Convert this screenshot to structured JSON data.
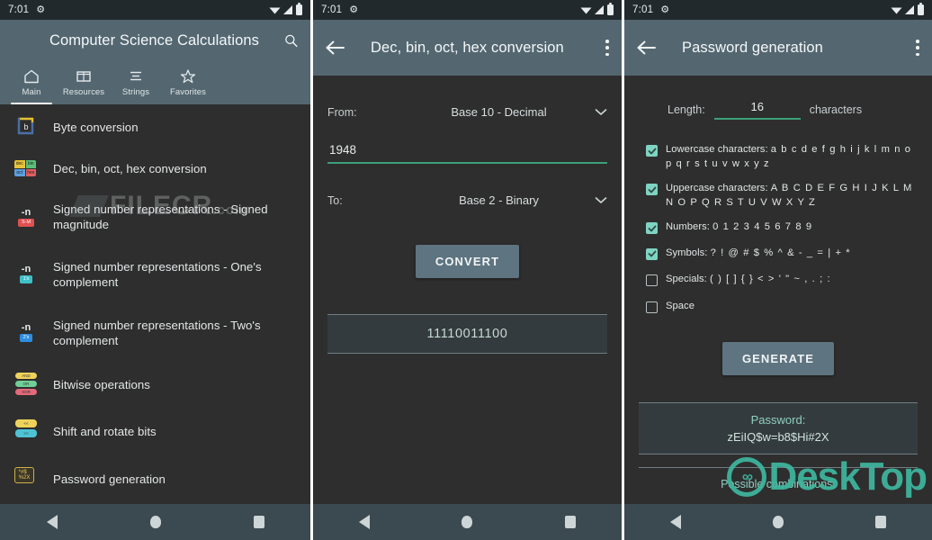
{
  "status_bar": {
    "time": "7:01",
    "gear_icon": "gear-icon",
    "wifi_icon": "wifi-icon",
    "signal_icon": "signal-icon",
    "battery_icon": "battery-icon"
  },
  "colors": {
    "appbar": "#546771",
    "background": "#2e2e2e",
    "accent_underline": "#3ba07a",
    "checkbox_checked": "#7fd3c2",
    "result_text": "#8fd0c2",
    "button": "#5e7480",
    "watermark": "#3fb79f"
  },
  "screen_main": {
    "title": "Computer Science Calculations",
    "menu_icon": "hamburger-menu-icon",
    "search_icon": "search-icon",
    "tabs": [
      {
        "label": "Main",
        "icon": "home-icon",
        "active": true
      },
      {
        "label": "Resources",
        "icon": "table-icon",
        "active": false
      },
      {
        "label": "Strings",
        "icon": "text-lines-icon",
        "active": false
      },
      {
        "label": "Favorites",
        "icon": "star-icon",
        "active": false
      }
    ],
    "list": [
      {
        "label": "Byte conversion",
        "icon": "byte-icon"
      },
      {
        "label": "Dec, bin, oct, hex conversion",
        "icon": "base-grid-icon"
      },
      {
        "label": "Signed number representations - Signed magnitude",
        "icon": "signed-magnitude-icon",
        "tag": "S-M"
      },
      {
        "label": "Signed number representations - One's complement",
        "icon": "ones-complement-icon",
        "tag": "1's"
      },
      {
        "label": "Signed number representations - Two's complement",
        "icon": "twos-complement-icon",
        "tag": "2's"
      },
      {
        "label": "Bitwise operations",
        "icon": "bitwise-icon",
        "pills": [
          "AND",
          "OR",
          "XOR"
        ]
      },
      {
        "label": "Shift and rotate bits",
        "icon": "shift-rotate-icon",
        "pills": [
          "<<",
          ">>"
        ]
      },
      {
        "label": "Password generation",
        "icon": "password-key-icon"
      }
    ],
    "watermark": "FILECR",
    "watermark_suffix": ".com"
  },
  "screen_conversion": {
    "title": "Dec, bin, oct, hex conversion",
    "back_icon": "back-arrow-icon",
    "overflow_icon": "kebab-menu-icon",
    "from_label": "From:",
    "from_value": "Base 10 - Decimal",
    "input_value": "1948",
    "to_label": "To:",
    "to_value": "Base 2 - Binary",
    "convert_button": "CONVERT",
    "result": "11110011100",
    "dropdown_icon": "chevron-down-icon"
  },
  "screen_password": {
    "title": "Password generation",
    "back_icon": "back-arrow-icon",
    "overflow_icon": "kebab-menu-icon",
    "length_label": "Length:",
    "length_value": "16",
    "length_unit": "characters",
    "options": [
      {
        "label": "Lowercase characters:",
        "charset": "a b c d e f g h i j k l m n o p q r s t u v w x y z",
        "checked": true
      },
      {
        "label": "Uppercase characters:",
        "charset": "A B C D E F G H I J K L M N O P Q R S T U V W X Y Z",
        "checked": true
      },
      {
        "label": "Numbers:",
        "charset": "0 1 2 3 4 5 6 7 8 9",
        "checked": true
      },
      {
        "label": "Symbols:",
        "charset": "? ! @ # $ % ^ & - _ = | + *",
        "checked": true
      },
      {
        "label": "Specials:",
        "charset": "( ) [ ] { } < > ' \" ~ , . ; :",
        "checked": false
      },
      {
        "label": "Space",
        "charset": "",
        "checked": false
      }
    ],
    "generate_button": "GENERATE",
    "password_label": "Password:",
    "password_value": "zEiIQ$w=b8$Hi#2X",
    "combinations_label": "Possible combinations:",
    "watermark": "DeskTop"
  },
  "nav_bar": {
    "back_icon": "nav-back-icon",
    "home_icon": "nav-home-icon",
    "recents_icon": "nav-recents-icon"
  }
}
